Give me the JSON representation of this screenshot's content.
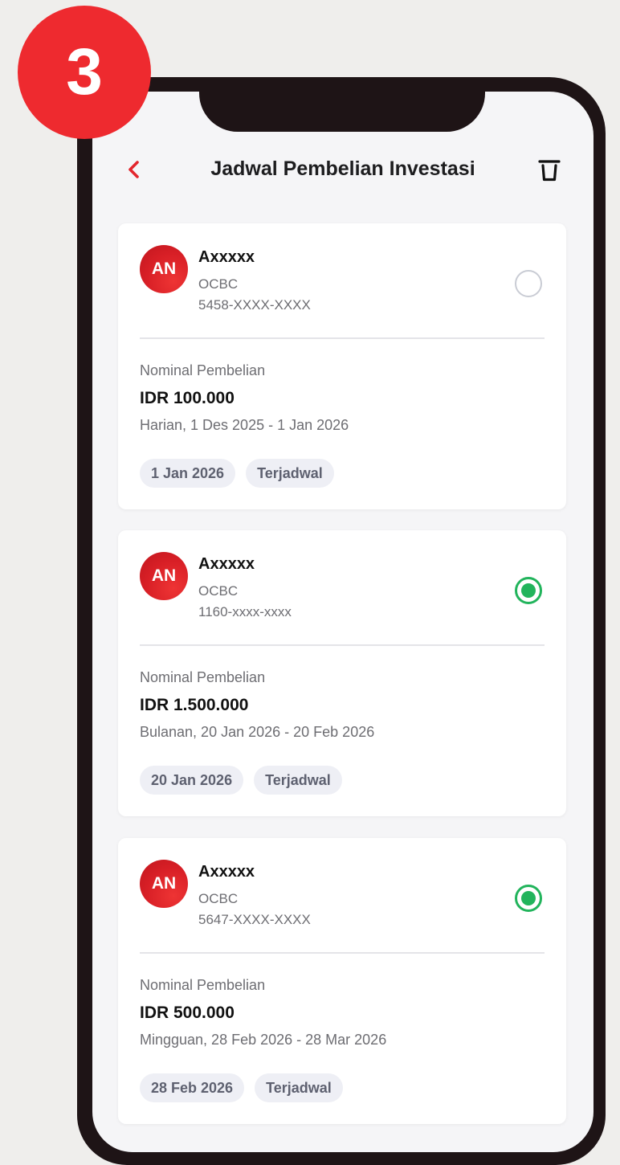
{
  "step_badge": "3",
  "header": {
    "title": "Jadwal Pembelian Investasi"
  },
  "cards": [
    {
      "initials": "AN",
      "name": "Axxxxx",
      "bank": "OCBC",
      "account": "5458-XXXX-XXXX",
      "selected": false,
      "nominal_label": "Nominal Pembelian",
      "amount": "IDR 100.000",
      "schedule": "Harian, 1 Des 2025 - 1 Jan 2026",
      "date_chip": "1 Jan 2026",
      "status_chip": "Terjadwal"
    },
    {
      "initials": "AN",
      "name": "Axxxxx",
      "bank": "OCBC",
      "account": "1160-xxxx-xxxx",
      "selected": true,
      "nominal_label": "Nominal Pembelian",
      "amount": "IDR 1.500.000",
      "schedule": "Bulanan, 20 Jan 2026 - 20 Feb 2026",
      "date_chip": "20 Jan 2026",
      "status_chip": "Terjadwal"
    },
    {
      "initials": "AN",
      "name": "Axxxxx",
      "bank": "OCBC",
      "account": "5647-XXXX-XXXX",
      "selected": true,
      "nominal_label": "Nominal Pembelian",
      "amount": "IDR 500.000",
      "schedule": "Mingguan, 28 Feb 2026 - 28 Mar 2026",
      "date_chip": "28 Feb 2026",
      "status_chip": "Terjadwal"
    }
  ],
  "icons": {
    "back": "chevron-left-icon",
    "delete": "trash-icon",
    "radio_off": "radio-unselected-icon",
    "radio_on": "radio-selected-icon"
  },
  "colors": {
    "brand_red": "#ee2a2f",
    "selected_green": "#22b45c",
    "phone_frame": "#1e1416"
  }
}
